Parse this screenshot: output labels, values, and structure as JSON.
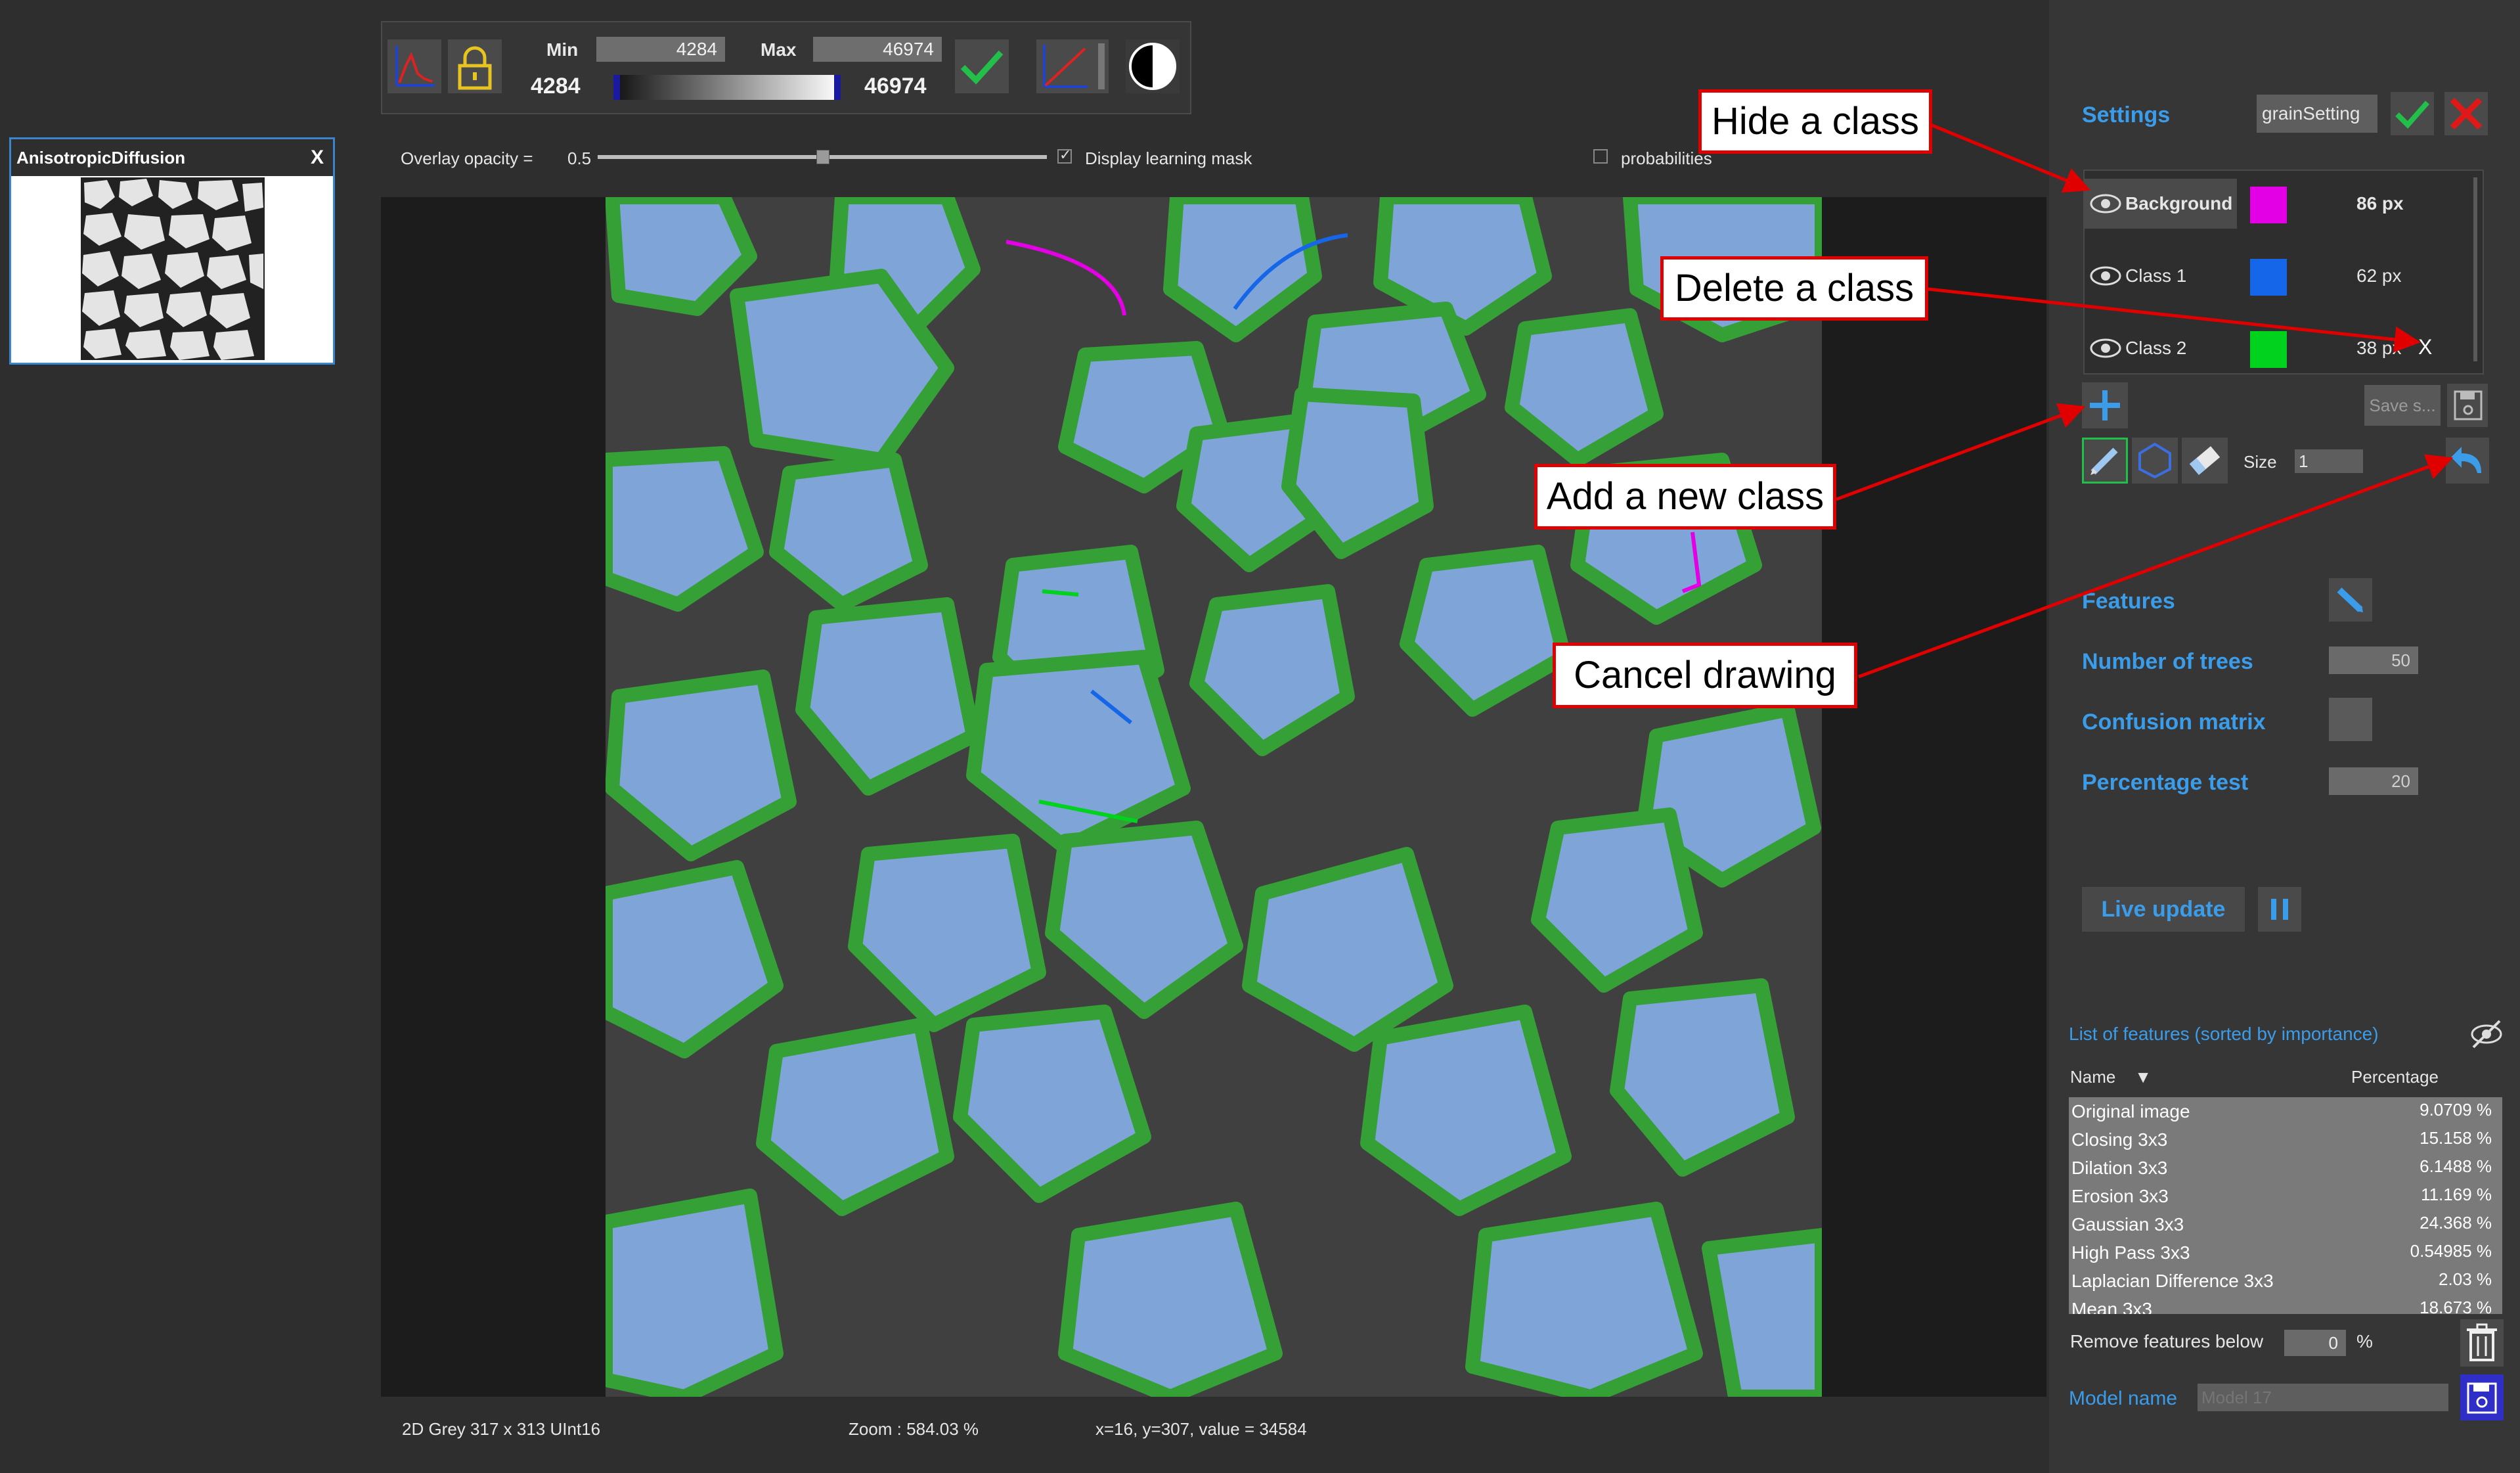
{
  "help_label": "?",
  "thumbnail": {
    "title": "AnisotropicDiffusion",
    "close_label": "X"
  },
  "toolbar": {
    "min_label": "Min",
    "min_field": "4284",
    "min_value": "4284",
    "max_label": "Max",
    "max_field": "46974",
    "max_value": "46974"
  },
  "overlay": {
    "opacity_label": "Overlay opacity =",
    "opacity_value": "0.5",
    "opacity_fraction": 0.5,
    "display_mask_label": "Display learning mask",
    "display_mask_checked": true,
    "probabilities_label": "probabilities",
    "probabilities_checked": false
  },
  "status": {
    "image_info": "2D Grey 317 x 313 UInt16",
    "zoom": "Zoom : 584.03 %",
    "cursor": "x=16, y=307, value = 34584"
  },
  "settings": {
    "label": "Settings",
    "preset": "grainSetting"
  },
  "classes": [
    {
      "name": "Background",
      "color": "#e400e4",
      "pixels": "86 px",
      "bold": true
    },
    {
      "name": "Class 1",
      "color": "#1566e8",
      "pixels": "62 px",
      "bold": false
    },
    {
      "name": "Class 2",
      "color": "#00d21e",
      "pixels": "38 px",
      "bold": false
    }
  ],
  "delete_label": "X",
  "save_label": "Save s...",
  "brush": {
    "size_label": "Size",
    "size_value": "1"
  },
  "params": {
    "features_label": "Features",
    "trees_label": "Number of trees",
    "trees_value": "50",
    "confusion_label": "Confusion matrix",
    "percentage_label": "Percentage test",
    "percentage_value": "20"
  },
  "live_update_label": "Live update",
  "features_list": {
    "title": "List of features (sorted by importance)",
    "col_name": "Name",
    "col_percentage": "Percentage",
    "rows": [
      {
        "name": "Original image",
        "pct": "9.0709 %"
      },
      {
        "name": "Closing 3x3",
        "pct": "15.158 %"
      },
      {
        "name": "Dilation 3x3",
        "pct": "6.1488 %"
      },
      {
        "name": "Erosion 3x3",
        "pct": "11.169 %"
      },
      {
        "name": "Gaussian 3x3",
        "pct": "24.368 %"
      },
      {
        "name": "High Pass 3x3",
        "pct": "0.54985 %"
      },
      {
        "name": "Laplacian Difference 3x3",
        "pct": "2.03 %"
      },
      {
        "name": "Mean 3x3",
        "pct": "18.673 %"
      }
    ]
  },
  "remove_features": {
    "label": "Remove features below",
    "value": "0",
    "unit": "%"
  },
  "model": {
    "label": "Model name",
    "placeholder": "Model 17"
  },
  "annotations": [
    {
      "text": "Hide a class"
    },
    {
      "text": "Delete a class"
    },
    {
      "text": "Add a new class"
    },
    {
      "text": "Cancel drawing"
    }
  ],
  "colors": {
    "accent": "#3b9dea",
    "callout_border": "#e00000",
    "arrow": "#e00000"
  }
}
